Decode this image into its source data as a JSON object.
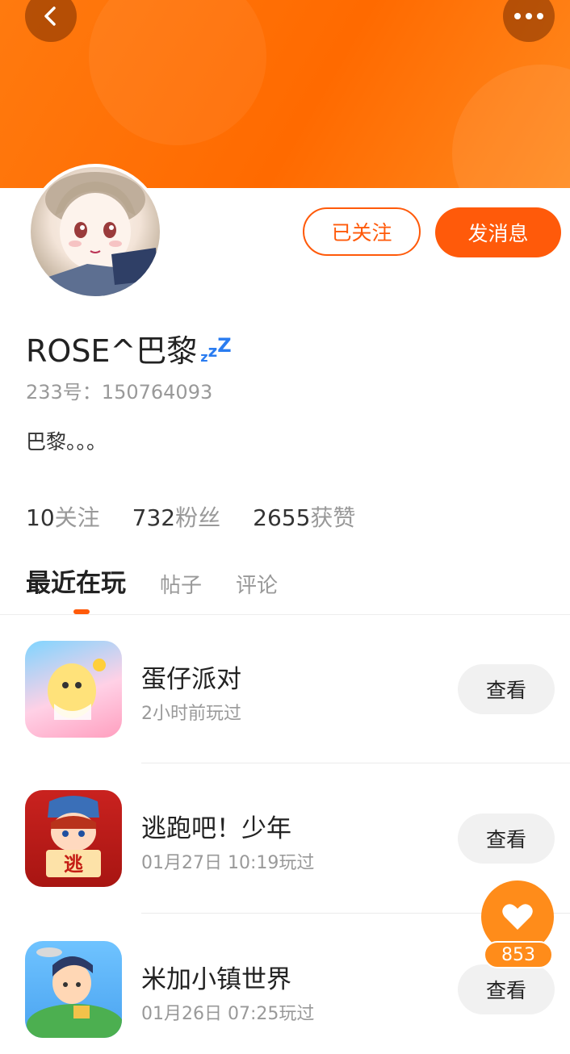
{
  "header": {
    "back_icon": "chevron-left-icon",
    "more_icon": "more-dots-icon",
    "banner_color": "#ff6a00"
  },
  "profile": {
    "followed_label": "已关注",
    "message_label": "发消息",
    "username": "ROSE^巴黎",
    "status_icon": "zzz-sleep-icon",
    "uid": "233号：150764093",
    "bio": "巴黎。。。",
    "stats": [
      {
        "num": "10",
        "label": "关注"
      },
      {
        "num": "732",
        "label": "粉丝"
      },
      {
        "num": "2655",
        "label": "获赞"
      }
    ]
  },
  "tabs": [
    {
      "label": "最近在玩",
      "active": true
    },
    {
      "label": "帖子",
      "active": false
    },
    {
      "label": "评论",
      "active": false
    }
  ],
  "games": [
    {
      "title": "蛋仔派对",
      "time": "2小时前玩过",
      "action": "查看"
    },
    {
      "title": "逃跑吧！少年",
      "time": "01月27日 10:19玩过",
      "action": "查看",
      "icon_badge": "逃"
    },
    {
      "title": "米加小镇世界",
      "time": "01月26日 07:25玩过",
      "action": "查看"
    }
  ],
  "like": {
    "icon": "heart-icon",
    "count": "853",
    "accent": "#ff8c1a"
  },
  "accent_color": "#ff5a0a"
}
